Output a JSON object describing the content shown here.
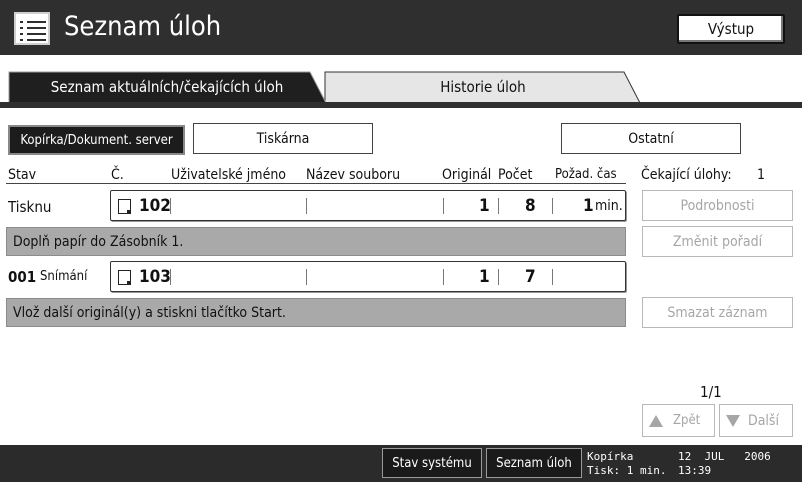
{
  "header": {
    "title": "Seznam úloh",
    "exit_label": "Výstup",
    "icon": "list-icon"
  },
  "tabs": [
    {
      "label": "Seznam aktuálních/čekajících úloh",
      "active": true
    },
    {
      "label": "Historie úloh",
      "active": false
    }
  ],
  "categories": {
    "copier": "Kopírka/Dokument. server",
    "printer": "Tiskárna",
    "other": "Ostatní"
  },
  "columns": {
    "status": "Stav",
    "number": "Č.",
    "user": "Uživatelské jméno",
    "file": "Název souboru",
    "originals": "Originál",
    "count": "Počet",
    "time": "Požad. čas"
  },
  "waiting": {
    "label": "Čekající úlohy:",
    "value": "1"
  },
  "jobs": [
    {
      "status": "Tisknu",
      "number": "102",
      "originals": "1",
      "count": "8",
      "time_value": "1",
      "time_unit": "min.",
      "message": "Doplň papír do Zásobník 1."
    },
    {
      "status_num": "001",
      "status": "Snímání",
      "number": "103",
      "originals": "1",
      "count": "7",
      "message": "Vlož další originál(y) a stiskni tlačítko Start."
    }
  ],
  "side": {
    "details": "Podrobnosti",
    "change_order": "Změnit pořadí",
    "delete_record": "Smazat záznam",
    "page": "1/1",
    "prev": "Zpět",
    "next": "Další"
  },
  "bottom": {
    "system_status": "Stav systému",
    "job_list": "Seznam úloh",
    "mode": "Kopírka",
    "print_label": "Tisk: 1 min.",
    "date": "12  JUL   2006",
    "time": "13:39"
  },
  "colors": {
    "dark": "#2f2f2f",
    "message_bar": "#a9a9a9",
    "disabled_text": "#a6a6a6"
  }
}
